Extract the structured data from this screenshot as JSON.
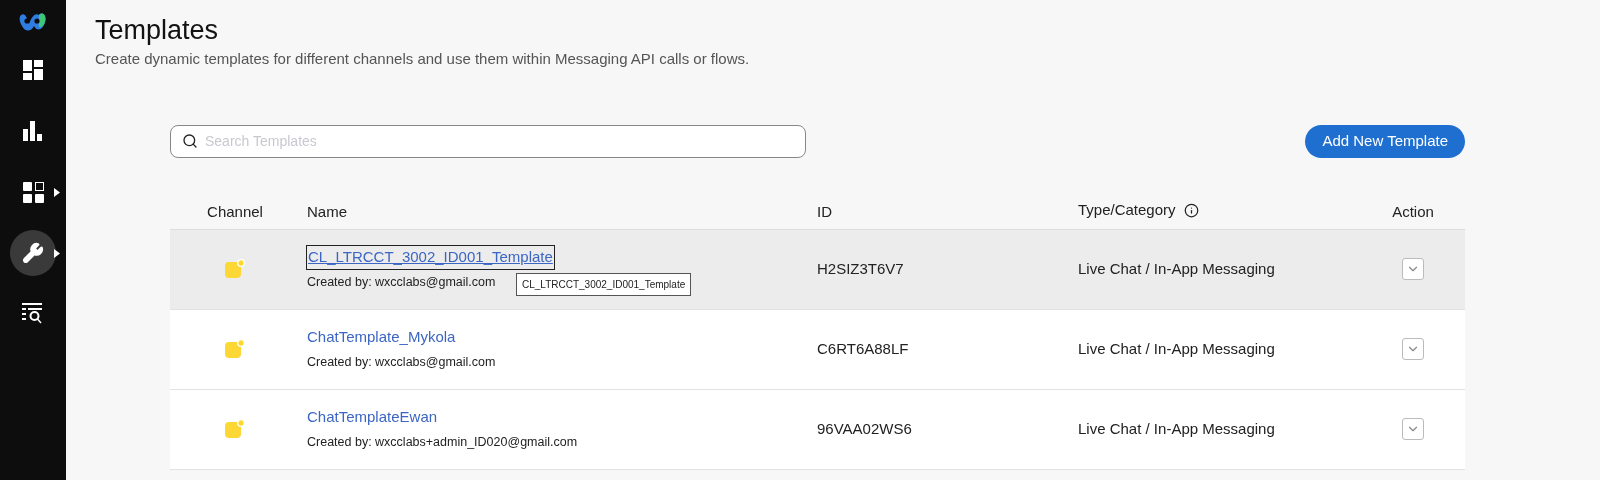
{
  "sidebar": {
    "items": [
      {
        "kind": "dashboard",
        "selected": false,
        "has_submenu": false
      },
      {
        "kind": "chart",
        "selected": false,
        "has_submenu": false
      },
      {
        "kind": "apps",
        "selected": false,
        "has_submenu": true
      },
      {
        "kind": "wrench",
        "selected": true,
        "has_submenu": true
      },
      {
        "kind": "report",
        "selected": false,
        "has_submenu": false
      }
    ]
  },
  "header": {
    "title": "Templates",
    "subtitle": "Create dynamic templates for different channels and use them within Messaging API calls or flows."
  },
  "search": {
    "placeholder": "Search Templates"
  },
  "add_button": "Add New Template",
  "table": {
    "columns": [
      "Channel",
      "Name",
      "ID",
      "Type/Category",
      "Action"
    ],
    "rows": [
      {
        "name": "CL_LTRCCT_3002_ID001_Template",
        "created_by": "Created by: wxcclabs@gmail.com",
        "id": "H2SIZ3T6V7",
        "type": "Live Chat / In-App Messaging",
        "highlighted": true,
        "tooltip": "CL_LTRCCT_3002_ID001_Template"
      },
      {
        "name": "ChatTemplate_Mykola",
        "created_by": "Created by: wxcclabs@gmail.com",
        "id": "C6RT6A88LF",
        "type": "Live Chat / In-App Messaging",
        "highlighted": false
      },
      {
        "name": "ChatTemplateEwan",
        "created_by": "Created by: wxcclabs+admin_ID020@gmail.com",
        "id": "96VAA02WS6",
        "type": "Live Chat / In-App Messaging",
        "highlighted": false
      }
    ]
  }
}
